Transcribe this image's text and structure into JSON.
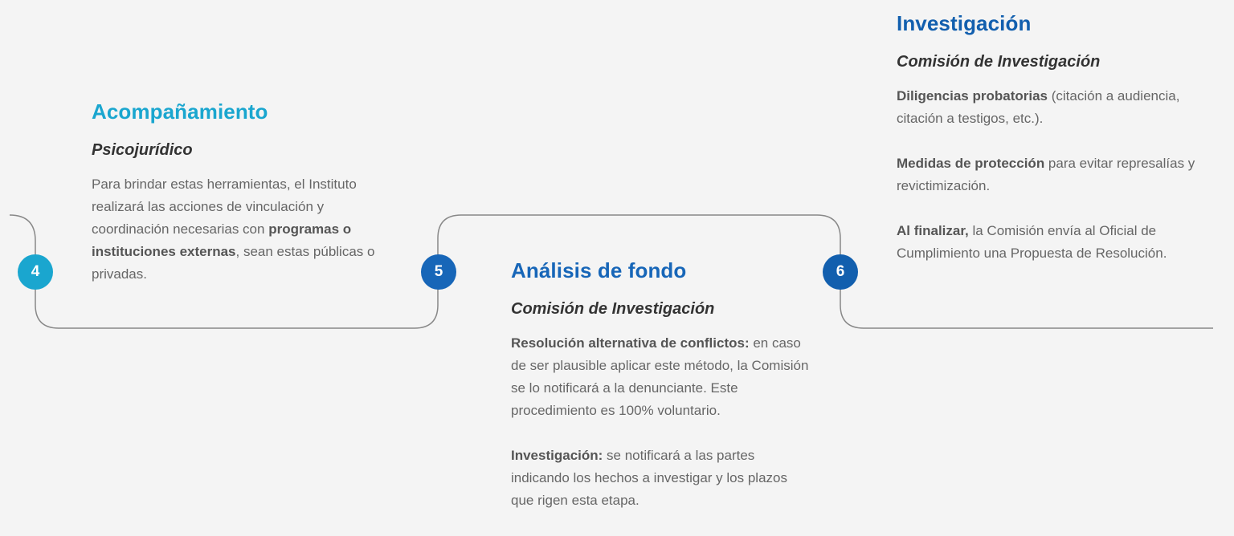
{
  "colors": {
    "step4": "#1aa6cf",
    "step5": "#1766b8",
    "step6": "#125fae",
    "line": "#888888"
  },
  "steps": [
    {
      "number": "4",
      "title": "Acompañamiento",
      "subtitle": "Psicojurídico",
      "paragraphs": [
        [
          {
            "text": "Para brindar estas herramientas, el Instituto realizará las acciones de vinculación y coordinación necesarias con ",
            "bold": false
          },
          {
            "text": "programas o instituciones externas",
            "bold": true
          },
          {
            "text": ", sean estas públicas o privadas.",
            "bold": false
          }
        ]
      ]
    },
    {
      "number": "5",
      "title": "Análisis de fondo",
      "subtitle": "Comisión de Investigación",
      "paragraphs": [
        [
          {
            "text": "Resolución alternativa de conflictos:",
            "bold": true
          },
          {
            "text": " en caso de ser plausible aplicar este método, la Comisión se lo notificará a la denunciante. Este procedimiento es 100% voluntario.",
            "bold": false
          }
        ],
        [
          {
            "text": "Investigación:",
            "bold": true
          },
          {
            "text": " se notificará a las partes indicando los hechos a investigar y los plazos que rigen esta etapa.",
            "bold": false
          }
        ]
      ]
    },
    {
      "number": "6",
      "title": "Investigación",
      "subtitle": "Comisión de Investigación",
      "paragraphs": [
        [
          {
            "text": "Diligencias probatorias",
            "bold": true
          },
          {
            "text": " (citación a audiencia, citación a testigos, etc.).",
            "bold": false
          }
        ],
        [
          {
            "text": "Medidas de protección",
            "bold": true
          },
          {
            "text": " para evitar represalías y revictimización.",
            "bold": false
          }
        ],
        [
          {
            "text": "Al finalizar,",
            "bold": true
          },
          {
            "text": " la Comisión envía al Oficial de Cumplimiento una Propuesta de Resolución.",
            "bold": false
          }
        ]
      ]
    }
  ]
}
